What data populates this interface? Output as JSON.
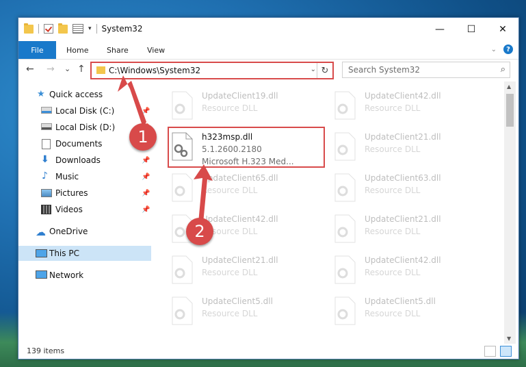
{
  "window": {
    "title": "System32",
    "controls": {
      "minimize": "—",
      "maximize": "☐",
      "close": "✕"
    }
  },
  "ribbon": {
    "file_tab": "File",
    "tabs": [
      "Home",
      "Share",
      "View"
    ]
  },
  "nav": {
    "back": "←",
    "forward": "→",
    "recent": "⌄",
    "up": "↑",
    "address": "C:\\Windows\\System32",
    "search_placeholder": "Search System32"
  },
  "sidebar": {
    "items": [
      {
        "label": "Quick access",
        "icon": "star-icon",
        "pinned": false
      },
      {
        "label": "Local Disk (C:)",
        "icon": "drive-icon",
        "pinned": true
      },
      {
        "label": "Local Disk (D:)",
        "icon": "drive-icon",
        "pinned": true
      },
      {
        "label": "Documents",
        "icon": "documents-icon",
        "pinned": true
      },
      {
        "label": "Downloads",
        "icon": "downloads-icon",
        "pinned": true
      },
      {
        "label": "Music",
        "icon": "music-icon",
        "pinned": true
      },
      {
        "label": "Pictures",
        "icon": "pictures-icon",
        "pinned": true
      },
      {
        "label": "Videos",
        "icon": "videos-icon",
        "pinned": true
      },
      {
        "label": "OneDrive",
        "icon": "cloud-icon",
        "pinned": false
      },
      {
        "label": "This PC",
        "icon": "computer-icon",
        "pinned": false,
        "selected": true
      },
      {
        "label": "Network",
        "icon": "network-icon",
        "pinned": false
      }
    ]
  },
  "files": {
    "left_column": [
      {
        "name": "UpdateClient19.dll",
        "type": "Resource DLL"
      },
      {
        "name": "h323msp.dll",
        "version": "5.1.2600.2180",
        "description": "Microsoft H.323 Med...",
        "selected": true
      },
      {
        "name": "UpdateClient65.dll",
        "type": "Resource DLL"
      },
      {
        "name": "UpdateClient42.dll",
        "type": "Resource DLL"
      },
      {
        "name": "UpdateClient21.dll",
        "type": "Resource DLL"
      },
      {
        "name": "UpdateClient5.dll",
        "type": "Resource DLL"
      }
    ],
    "right_column": [
      {
        "name": "UpdateClient42.dll",
        "type": "Resource DLL"
      },
      {
        "name": "UpdateClient21.dll",
        "type": "Resource DLL"
      },
      {
        "name": "UpdateClient63.dll",
        "type": "Resource DLL"
      },
      {
        "name": "UpdateClient21.dll",
        "type": "Resource DLL"
      },
      {
        "name": "UpdateClient42.dll",
        "type": "Resource DLL"
      },
      {
        "name": "UpdateClient5.dll",
        "type": "Resource DLL"
      }
    ]
  },
  "status": {
    "item_count": "139 items"
  },
  "annotations": {
    "step1": "1",
    "step2": "2",
    "color": "#d84a4a"
  }
}
